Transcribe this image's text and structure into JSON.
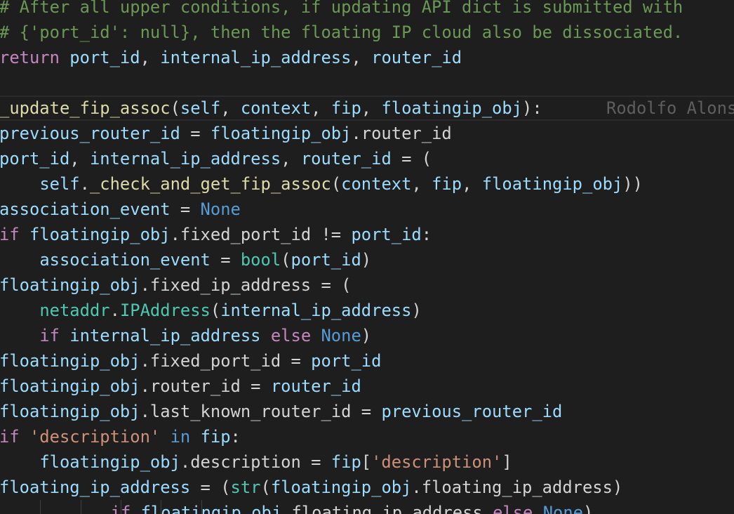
{
  "colors": {
    "background": "#1e1e1e",
    "comment": "#6a9955",
    "keyword": "#c586c0",
    "variable": "#9cdcfe",
    "function": "#dcdcaa",
    "constant": "#569cd6",
    "builtin": "#4ec9b0",
    "string": "#ce9178",
    "plain": "#d4d4d4",
    "blame": "#5f5f5f"
  },
  "editor": {
    "blame_annotation": "Rodolfo Alons",
    "lines": [
      [
        [
          "t-comment",
          "# After all upper conditions, if updating API dict is submitted with"
        ]
      ],
      [
        [
          "t-comment",
          "# {'port_id': null}, then the floating IP cloud also be dissociated."
        ]
      ],
      [
        [
          "t-keyword",
          "return"
        ],
        [
          "t-plain",
          " "
        ],
        [
          "t-var",
          "port_id"
        ],
        [
          "t-plain",
          ", "
        ],
        [
          "t-var",
          "internal_ip_address"
        ],
        [
          "t-plain",
          ", "
        ],
        [
          "t-var",
          "router_id"
        ]
      ],
      [],
      [
        [
          "t-func",
          "_update_fip_assoc"
        ],
        [
          "t-plain",
          "("
        ],
        [
          "t-var",
          "self"
        ],
        [
          "t-plain",
          ", "
        ],
        [
          "t-var",
          "context"
        ],
        [
          "t-plain",
          ", "
        ],
        [
          "t-var",
          "fip"
        ],
        [
          "t-plain",
          ", "
        ],
        [
          "t-var",
          "floatingip_obj"
        ],
        [
          "t-plain",
          "):"
        ]
      ],
      [
        [
          "t-var",
          "previous_router_id"
        ],
        [
          "t-plain",
          " = "
        ],
        [
          "t-var",
          "floatingip_obj"
        ],
        [
          "t-plain",
          ".router_id"
        ]
      ],
      [
        [
          "t-var",
          "port_id"
        ],
        [
          "t-plain",
          ", "
        ],
        [
          "t-var",
          "internal_ip_address"
        ],
        [
          "t-plain",
          ", "
        ],
        [
          "t-var",
          "router_id"
        ],
        [
          "t-plain",
          " = ("
        ]
      ],
      [
        [
          "t-plain",
          "    "
        ],
        [
          "t-var",
          "self"
        ],
        [
          "t-plain",
          "."
        ],
        [
          "t-func",
          "_check_and_get_fip_assoc"
        ],
        [
          "t-plain",
          "("
        ],
        [
          "t-var",
          "context"
        ],
        [
          "t-plain",
          ", "
        ],
        [
          "t-var",
          "fip"
        ],
        [
          "t-plain",
          ", "
        ],
        [
          "t-var",
          "floatingip_obj"
        ],
        [
          "t-plain",
          "))"
        ]
      ],
      [
        [
          "t-var",
          "association_event"
        ],
        [
          "t-plain",
          " = "
        ],
        [
          "t-const",
          "None"
        ]
      ],
      [
        [
          "t-keyword",
          "if"
        ],
        [
          "t-plain",
          " "
        ],
        [
          "t-var",
          "floatingip_obj"
        ],
        [
          "t-plain",
          ".fixed_port_id != "
        ],
        [
          "t-var",
          "port_id"
        ],
        [
          "t-plain",
          ":"
        ]
      ],
      [
        [
          "t-plain",
          "    "
        ],
        [
          "t-var",
          "association_event"
        ],
        [
          "t-plain",
          " = "
        ],
        [
          "t-class",
          "bool"
        ],
        [
          "t-plain",
          "("
        ],
        [
          "t-var",
          "port_id"
        ],
        [
          "t-plain",
          ")"
        ]
      ],
      [
        [
          "t-var",
          "floatingip_obj"
        ],
        [
          "t-plain",
          ".fixed_ip_address = ("
        ]
      ],
      [
        [
          "t-plain",
          "    "
        ],
        [
          "t-class",
          "netaddr"
        ],
        [
          "t-plain",
          "."
        ],
        [
          "t-class",
          "IPAddress"
        ],
        [
          "t-plain",
          "("
        ],
        [
          "t-var",
          "internal_ip_address"
        ],
        [
          "t-plain",
          ")"
        ]
      ],
      [
        [
          "t-plain",
          "    "
        ],
        [
          "t-keyword",
          "if"
        ],
        [
          "t-plain",
          " "
        ],
        [
          "t-var",
          "internal_ip_address"
        ],
        [
          "t-plain",
          " "
        ],
        [
          "t-keyword",
          "else"
        ],
        [
          "t-plain",
          " "
        ],
        [
          "t-const",
          "None"
        ],
        [
          "t-plain",
          ")"
        ]
      ],
      [
        [
          "t-var",
          "floatingip_obj"
        ],
        [
          "t-plain",
          ".fixed_port_id = "
        ],
        [
          "t-var",
          "port_id"
        ]
      ],
      [
        [
          "t-var",
          "floatingip_obj"
        ],
        [
          "t-plain",
          ".router_id = "
        ],
        [
          "t-var",
          "router_id"
        ]
      ],
      [
        [
          "t-var",
          "floatingip_obj"
        ],
        [
          "t-plain",
          ".last_known_router_id = "
        ],
        [
          "t-var",
          "previous_router_id"
        ]
      ],
      [
        [
          "t-keyword",
          "if"
        ],
        [
          "t-plain",
          " "
        ],
        [
          "t-string",
          "'description'"
        ],
        [
          "t-plain",
          " "
        ],
        [
          "t-const",
          "in"
        ],
        [
          "t-plain",
          " "
        ],
        [
          "t-var",
          "fip"
        ],
        [
          "t-plain",
          ":"
        ]
      ],
      [
        [
          "t-plain",
          "    "
        ],
        [
          "t-var",
          "floatingip_obj"
        ],
        [
          "t-plain",
          ".description = "
        ],
        [
          "t-var",
          "fip"
        ],
        [
          "t-plain",
          "["
        ],
        [
          "t-string",
          "'description'"
        ],
        [
          "t-plain",
          "]"
        ]
      ],
      [
        [
          "t-var",
          "floating_ip_address"
        ],
        [
          "t-plain",
          " = ("
        ],
        [
          "t-class",
          "str"
        ],
        [
          "t-plain",
          "("
        ],
        [
          "t-var",
          "floatingip_obj"
        ],
        [
          "t-plain",
          ".floating_ip_address)"
        ]
      ],
      [
        [
          "t-plain",
          "        "
        ],
        [
          "t-keyword",
          "if"
        ],
        [
          "t-plain",
          " "
        ],
        [
          "t-var",
          "floatingip_obj"
        ],
        [
          "t-plain",
          ".floating_ip_address "
        ],
        [
          "t-keyword",
          "else"
        ],
        [
          "t-plain",
          " "
        ],
        [
          "t-const",
          "None"
        ],
        [
          "t-plain",
          ")"
        ]
      ]
    ]
  }
}
